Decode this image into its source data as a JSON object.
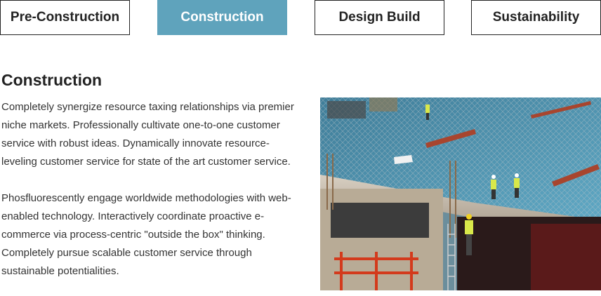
{
  "tabs": [
    {
      "label": "Pre-Construction",
      "active": false
    },
    {
      "label": "Construction",
      "active": true
    },
    {
      "label": "Design Build",
      "active": false
    },
    {
      "label": "Sustainability",
      "active": false
    }
  ],
  "content": {
    "title": "Construction",
    "paragraphs": [
      "Completely synergize resource taxing relationships via premier niche markets. Professionally cultivate one-to-one customer service with robust ideas. Dynamically innovate resource-leveling customer service for state of the art customer service.",
      "Phosfluorescently engage worldwide methodologies with web-enabled technology. Interactively coordinate proactive e-commerce via process-centric \"outside the box\" thinking. Completely pursue scalable customer service through sustainable potentialities."
    ]
  },
  "colors": {
    "active_tab": "#5fa3bc",
    "border": "#222222",
    "text": "#222222"
  },
  "image": {
    "icon": "construction-site-photo"
  }
}
